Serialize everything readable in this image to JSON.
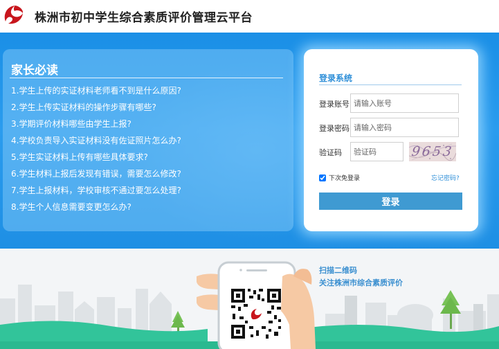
{
  "header": {
    "title": "株洲市初中学生综合素质评价管理云平台",
    "logo_icon": "red-swirl-logo-icon"
  },
  "colors": {
    "brand_red": "#c8161d",
    "banner_blue": "#1e8fe4",
    "login_accent": "#2f8fd8",
    "login_button": "#3f9ad2"
  },
  "parent_section": {
    "title": "家长必读",
    "items": [
      "1.学生上传的实证材料老师看不到是什么原因?",
      "2.学生上传实证材料的操作步骤有哪些?",
      "3.学期评价材料哪些由学生上报?",
      "4.学校负责导入实证材料没有佐证照片怎么办?",
      "5.学生实证材料上传有哪些具体要求?",
      "6.学生材料上报后发现有错误，需要怎么修改?",
      "7.学生上报材料，学校审核不通过要怎么处理?",
      "8.学生个人信息需要变更怎么办?"
    ]
  },
  "login": {
    "title": "登录系统",
    "account_label": "登录账号",
    "account_placeholder": "请输入账号",
    "password_label": "登录密码",
    "password_placeholder": "请输入密码",
    "captcha_label": "验证码",
    "captcha_placeholder": "验证码",
    "captcha_text": "9653",
    "remember_label": "下次免登录",
    "remember_checked": true,
    "forgot_label": "忘记密码?",
    "button_label": "登录"
  },
  "qr_section": {
    "line1": "扫描二维码",
    "line2": "关注株洲市综合素质评价",
    "qr_icon": "qr-code-icon"
  }
}
